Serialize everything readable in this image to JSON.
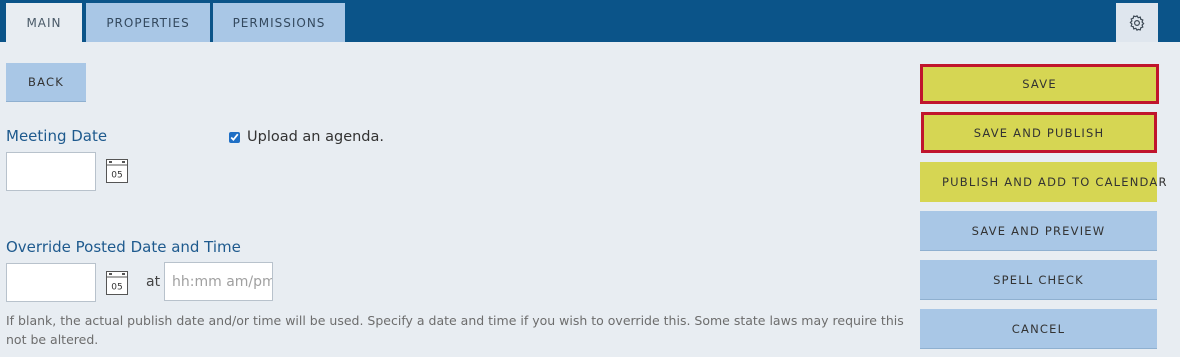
{
  "tabs": [
    {
      "label": "MAIN",
      "active": true
    },
    {
      "label": "PROPERTIES",
      "active": false
    },
    {
      "label": "PERMISSIONS",
      "active": false
    }
  ],
  "settings_icon": "gear-icon",
  "back_button": "BACK",
  "meeting_date": {
    "label": "Meeting Date",
    "value": "",
    "calendar_day": "05",
    "calendar_icon": "calendar-icon"
  },
  "agenda": {
    "label": "Upload an agenda.",
    "checked": true
  },
  "override": {
    "label": "Override Posted Date and Time",
    "date_value": "",
    "calendar_day": "05",
    "at_label": "at",
    "time_placeholder": "hh:mm am/pm",
    "help_text": "If blank, the actual publish date and/or time will be used. Specify a date and time if you wish to override this. Some state laws may require this not be altered."
  },
  "actions": {
    "save": "SAVE",
    "save_and_publish": "SAVE AND PUBLISH",
    "publish_and_add": "PUBLISH AND ADD TO CALENDAR",
    "save_and_preview": "SAVE AND PREVIEW",
    "spell_check": "SPELL CHECK",
    "cancel": "CANCEL"
  },
  "colors": {
    "header": "#0b5489",
    "tab": "#a9c7e6",
    "highlight": "#d6d653",
    "outline": "#c0152d"
  }
}
